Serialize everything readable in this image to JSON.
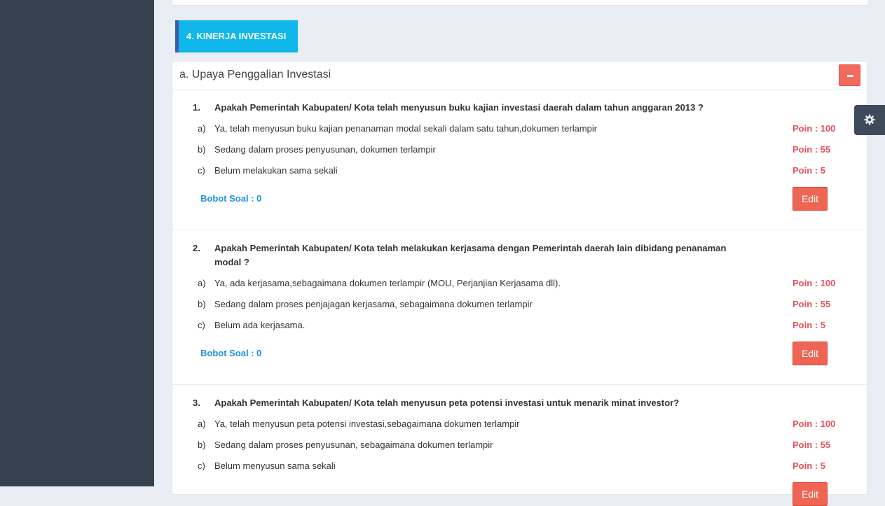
{
  "section": {
    "title": "4. KINERJA INVESTASI"
  },
  "panel": {
    "title": "a. Upaya Penggalian Investasi"
  },
  "questions": [
    {
      "number": "1.",
      "text": "Apakah Pemerintah Kabupaten/ Kota telah menyusun buku kajian investasi daerah dalam tahun anggaran 2013 ?",
      "options": [
        {
          "letter": "a)",
          "text": "Ya, telah menyusun buku kajian penanaman modal sekali dalam satu tahun,dokumen terlampir",
          "poin": "Poin : 100"
        },
        {
          "letter": "b)",
          "text": "Sedang dalam proses penyusunan, dokumen terlampir",
          "poin": "Poin : 55"
        },
        {
          "letter": "c)",
          "text": "Belum melakukan sama sekali",
          "poin": "Poin : 5"
        }
      ],
      "bobot": "Bobot Soal : 0",
      "edit_label": "Edit"
    },
    {
      "number": "2.",
      "text": "Apakah Pemerintah Kabupaten/ Kota telah melakukan kerjasama dengan Pemerintah daerah lain dibidang penanaman modal ?",
      "options": [
        {
          "letter": "a)",
          "text": "Ya, ada kerjasama,sebagaimana dokumen terlampir (MOU, Perjanjian Kerjasama dll).",
          "poin": "Poin : 100"
        },
        {
          "letter": "b)",
          "text": "Sedang dalam proses penjajagan kerjasama, sebagaimana dokumen terlampir",
          "poin": "Poin : 55"
        },
        {
          "letter": "c)",
          "text": "Belum ada kerjasama.",
          "poin": "Poin : 5"
        }
      ],
      "bobot": "Bobot Soal : 0",
      "edit_label": "Edit"
    },
    {
      "number": "3.",
      "text": "Apakah Pemerintah Kabupaten/ Kota telah menyusun peta potensi investasi untuk menarik minat investor?",
      "options": [
        {
          "letter": "a)",
          "text": "Ya, telah menyusun peta potensi investasi,sebagaimana dokumen terlampir",
          "poin": "Poin : 100"
        },
        {
          "letter": "b)",
          "text": "Sedang dalam proses penyusunan, sebagaimana dokumen terlampir",
          "poin": "Poin : 55"
        },
        {
          "letter": "c)",
          "text": "Belum menyusun sama sekali",
          "poin": "Poin : 5"
        }
      ],
      "edit_label": "Edit"
    }
  ],
  "icons": {
    "collapse": "minus-icon",
    "settings": "gear-icon"
  },
  "colors": {
    "section_bg": "#0fb7ea",
    "poin": "#e7505a",
    "bobot": "#1e90e0",
    "button": "#ef6452",
    "sidebar": "#364150"
  }
}
